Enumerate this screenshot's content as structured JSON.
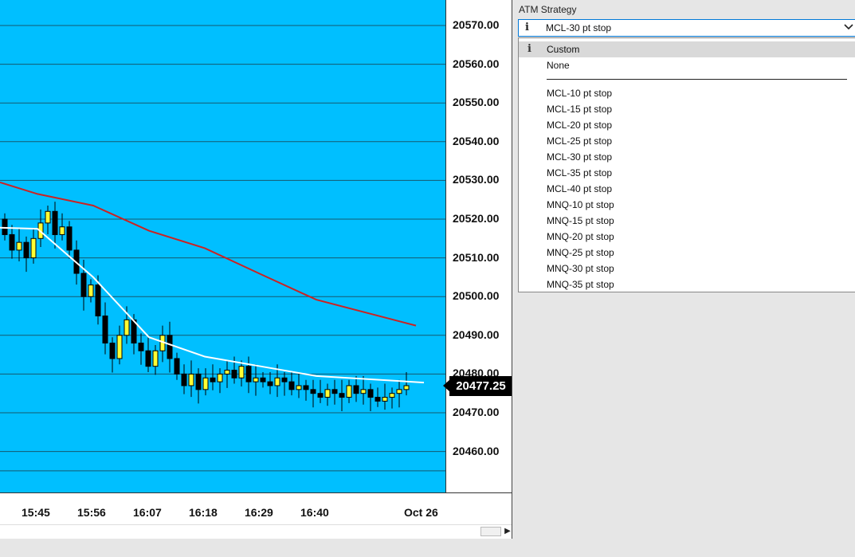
{
  "chart": {
    "price_ticks": [
      "20570.00",
      "20560.00",
      "20550.00",
      "20540.00",
      "20530.00",
      "20520.00",
      "20510.00",
      "20500.00",
      "20490.00",
      "20480.00",
      "20470.00",
      "20460.00"
    ],
    "current_price": "20477.25",
    "time_ticks": [
      "15:45",
      "15:56",
      "16:07",
      "16:18",
      "16:29",
      "16:40",
      "Oct 26"
    ],
    "panel_number": "1",
    "colors": {
      "background": "#00bfff",
      "up_candle": "#ffff33",
      "down_candle": "#000000",
      "fast_ma": "#ffffff",
      "slow_ma": "#cc2222",
      "indicator_bar": "#c5e84f"
    }
  },
  "chart_data": {
    "type": "line",
    "title": "",
    "x": [
      "15:45",
      "15:56",
      "16:07",
      "16:18",
      "16:29",
      "16:40",
      "Oct 26"
    ],
    "ylim": [
      20452,
      20577
    ],
    "series": [
      {
        "values": [
          20526.5,
          20523.5,
          20517.0,
          20512.5,
          20505.8,
          20499.2,
          20492.5
        ]
      },
      {
        "values": [
          20517.5,
          20505.0,
          20489.5,
          20484.5,
          20482.0,
          20479.5,
          20477.8
        ]
      }
    ],
    "last_price": 20477.25
  },
  "atm": {
    "label": "ATM Strategy",
    "selected": "MCL-30 pt stop",
    "info_icon": "i",
    "options": [
      "Custom",
      "None",
      "MCL-10 pt stop",
      "MCL-15 pt stop",
      "MCL-20 pt stop",
      "MCL-25 pt stop",
      "MCL-30 pt stop",
      "MCL-35 pt stop",
      "MCL-40 pt stop",
      "MNQ-10 pt stop",
      "MNQ-15 pt stop",
      "MNQ-20 pt stop",
      "MNQ-25 pt stop",
      "MNQ-30 pt stop",
      "MNQ-35 pt stop"
    ]
  }
}
